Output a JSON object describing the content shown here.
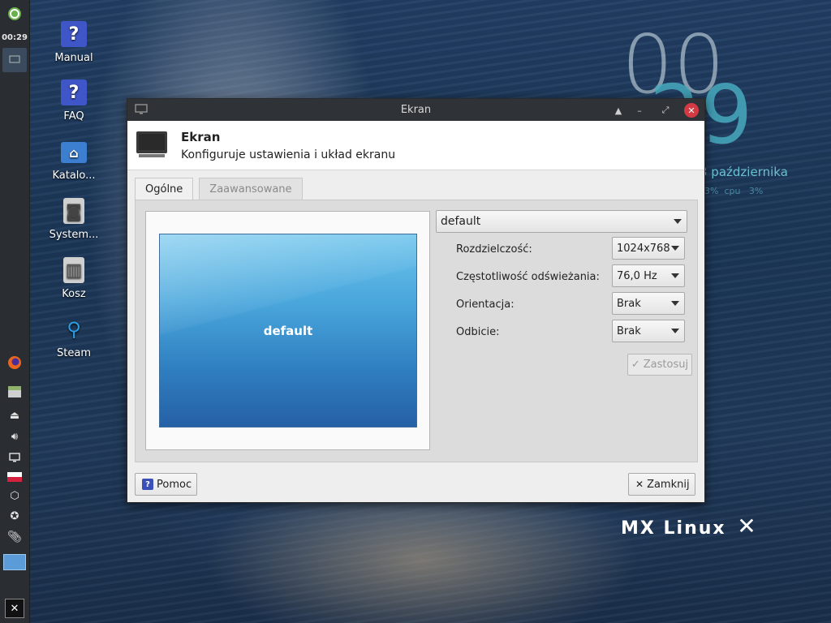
{
  "panel": {
    "clock": "00:29"
  },
  "desktop": {
    "icons": [
      {
        "label": "Manual",
        "glyph": "?"
      },
      {
        "label": "FAQ",
        "glyph": "?"
      },
      {
        "label": "Katalo...",
        "glyph": "⌂"
      },
      {
        "label": "System...",
        "glyph": "◙"
      },
      {
        "label": "Kosz",
        "glyph": "▥"
      },
      {
        "label": "Steam",
        "glyph": "⚲"
      }
    ],
    "conky_time_hours": "00",
    "conky_time_minutes": "29",
    "conky_date": "3 października",
    "conky_stats": "3%  cpu   3%",
    "brand": "MX Linux"
  },
  "window": {
    "title": "Ekran",
    "header_title": "Ekran",
    "header_subtitle": "Konfiguruje ustawienia i układ ekranu",
    "tabs": [
      {
        "label": "Ogólne",
        "active": true
      },
      {
        "label": "Zaawansowane",
        "active": false
      }
    ],
    "preview_label": "default",
    "display_select": "default",
    "settings": {
      "resolution_label": "Rozdzielczość:",
      "resolution_value": "1024x768",
      "refresh_label": "Częstotliwość odświeżania:",
      "refresh_value": "76,0 Hz",
      "orientation_label": "Orientacja:",
      "orientation_value": "Brak",
      "reflection_label": "Odbicie:",
      "reflection_value": "Brak"
    },
    "apply_label": "Zastosuj",
    "help_label": "Pomoc",
    "close_label": "Zamknij"
  },
  "colors": {
    "titlebar": "#2f3236",
    "close": "#d43a44",
    "panel": "#2a2e33"
  }
}
